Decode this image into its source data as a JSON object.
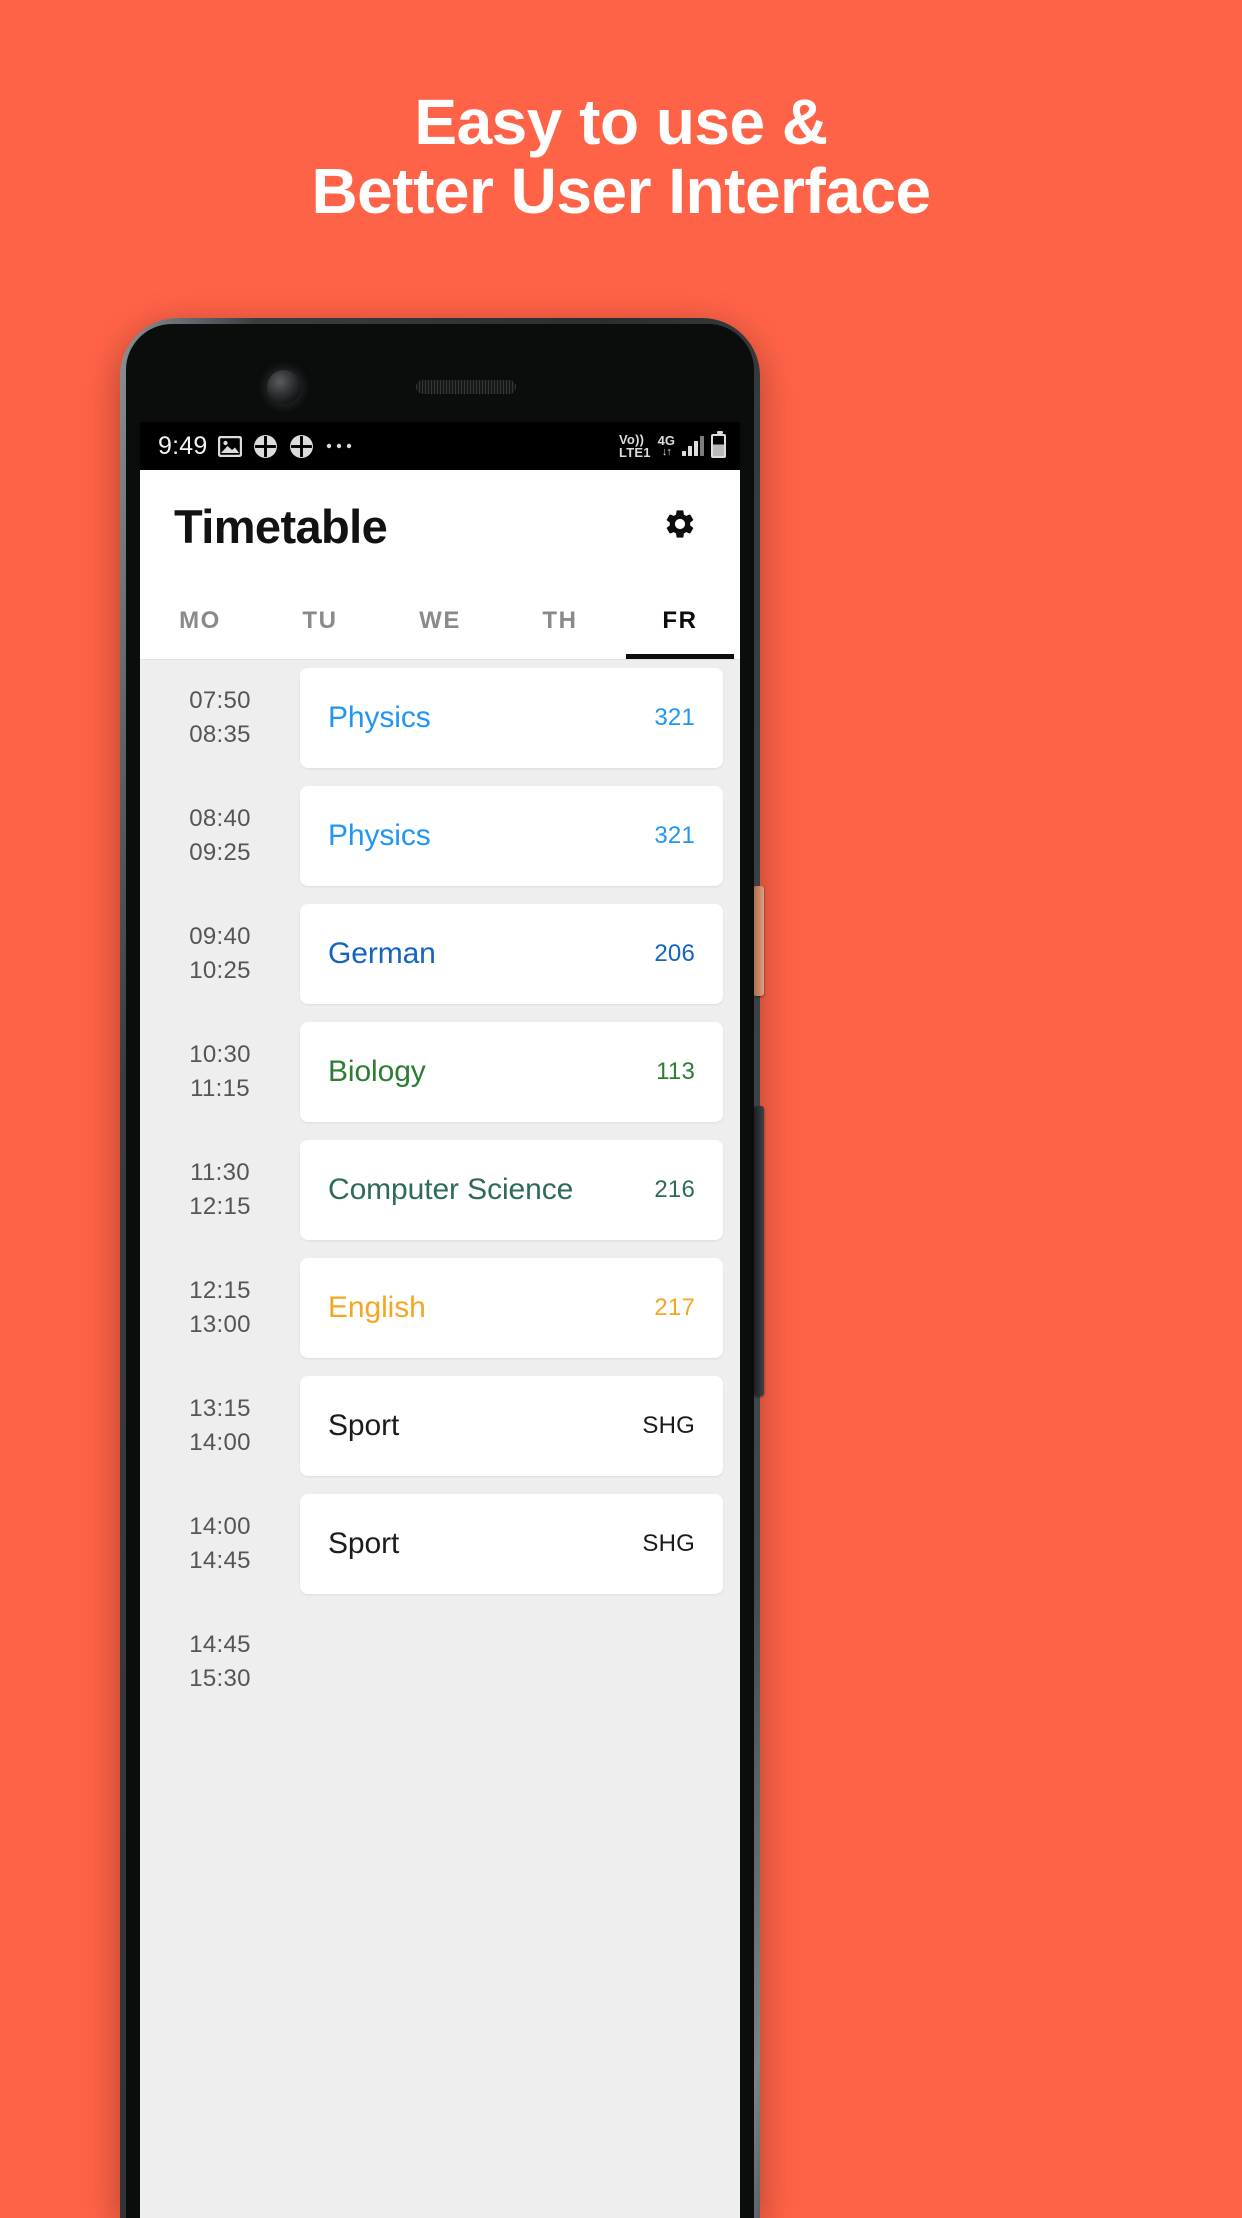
{
  "theme": {
    "background": "#FF6347",
    "headline_color": "#FFFFFF",
    "card_background": "#FFFFFF",
    "list_background": "#EEEEEE",
    "active_tab_color": "#0D0D0D",
    "inactive_tab_color": "#8A8A8A",
    "time_text_color": "#555555"
  },
  "headline": {
    "line1": "Easy to use &",
    "line2": "Better User Interface"
  },
  "status_bar": {
    "time": "9:49",
    "icons": [
      {
        "name": "image-icon",
        "glyph": "ὛC"
      },
      {
        "name": "app-badge-icon-1",
        "glyph": "✣"
      },
      {
        "name": "app-badge-icon-2",
        "glyph": "✣"
      },
      {
        "name": "more-notifications-icon",
        "glyph": "•••"
      }
    ],
    "volte_line1": "Vo))",
    "volte_line2": "LTE1",
    "network": "4G",
    "data_arrows": "↓↑",
    "signal_name": "signal-bars-icon",
    "battery_name": "battery-icon"
  },
  "app_bar": {
    "title": "Timetable",
    "settings_icon": "gear-icon"
  },
  "tabs": [
    {
      "label": "MO",
      "active": false
    },
    {
      "label": "TU",
      "active": false
    },
    {
      "label": "WE",
      "active": false
    },
    {
      "label": "TH",
      "active": false
    },
    {
      "label": "FR",
      "active": true
    }
  ],
  "schedule": [
    {
      "start": "07:50",
      "end": "08:35",
      "subject": "Physics",
      "room": "321",
      "color": "#2196F3"
    },
    {
      "start": "08:40",
      "end": "09:25",
      "subject": "Physics",
      "room": "321",
      "color": "#2196F3"
    },
    {
      "start": "09:40",
      "end": "10:25",
      "subject": "German",
      "room": "206",
      "color": "#1565C0"
    },
    {
      "start": "10:30",
      "end": "11:15",
      "subject": "Biology",
      "room": "113",
      "color": "#2E7D32"
    },
    {
      "start": "11:30",
      "end": "12:15",
      "subject": "Computer Science",
      "room": "216",
      "color": "#2E6B5E"
    },
    {
      "start": "12:15",
      "end": "13:00",
      "subject": "English",
      "room": "217",
      "color": "#F5A623"
    },
    {
      "start": "13:15",
      "end": "14:00",
      "subject": "Sport",
      "room": "SHG",
      "color": "#1C1C1C"
    },
    {
      "start": "14:00",
      "end": "14:45",
      "subject": "Sport",
      "room": "SHG",
      "color": "#1C1C1C"
    },
    {
      "start": "14:45",
      "end": "15:30",
      "subject": "",
      "room": "",
      "color": "#1C1C1C"
    }
  ],
  "device": {
    "power_button": "power-button",
    "volume_button": "volume-rocker-button",
    "camera": "front-camera",
    "earpiece": "earpiece-speaker"
  }
}
